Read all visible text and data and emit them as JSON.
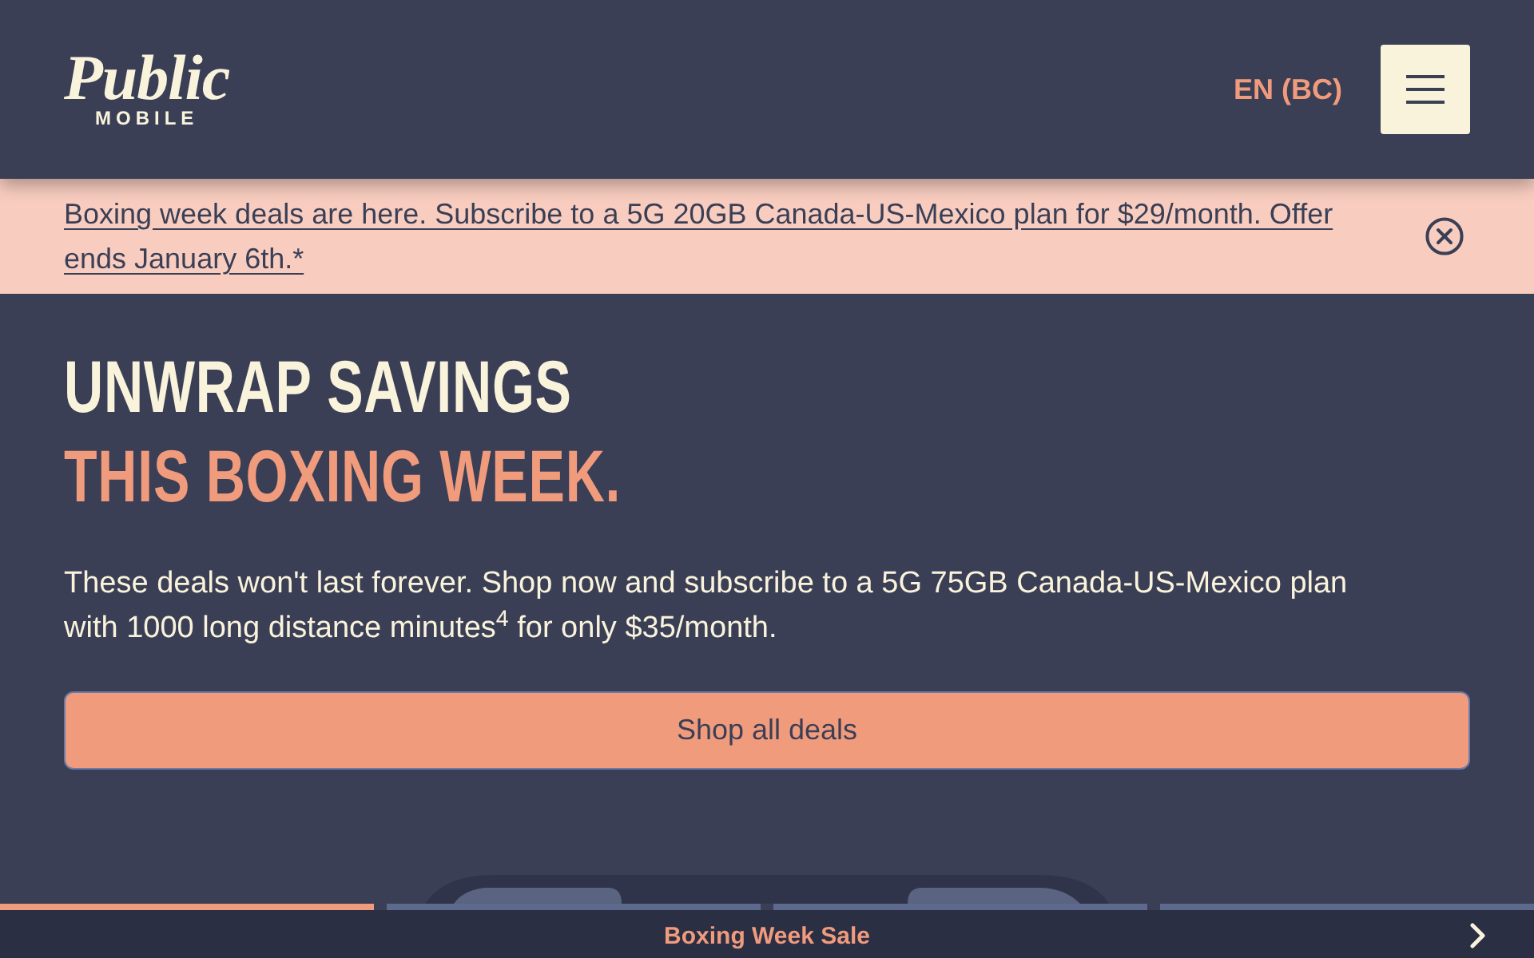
{
  "header": {
    "logo": {
      "wordmark": "Public",
      "tagline": "MOBILE"
    },
    "language": "EN (BC)"
  },
  "banner": {
    "message": "Boxing week deals are here. Subscribe to a 5G 20GB Canada-US-Mexico plan for $29/month. Offer ends January 6th.*"
  },
  "hero": {
    "headline": [
      {
        "text": "UNWRAP SAVINGS",
        "accent": false
      },
      {
        "text": "THIS BOXING WEEK.",
        "accent": true
      }
    ],
    "body": "These deals won't last forever. Shop now and subscribe to a 5G 75GB Canada-US-Mexico plan with 1000 long distance minutes$^{4}$ for only $35/month.",
    "button": "Shop all deals"
  },
  "carousel": {
    "indicators": [
      {
        "selected": true
      },
      {
        "selected": false
      },
      {
        "selected": false
      },
      {
        "selected": false
      }
    ],
    "caption": "Boxing Week Sale"
  }
}
